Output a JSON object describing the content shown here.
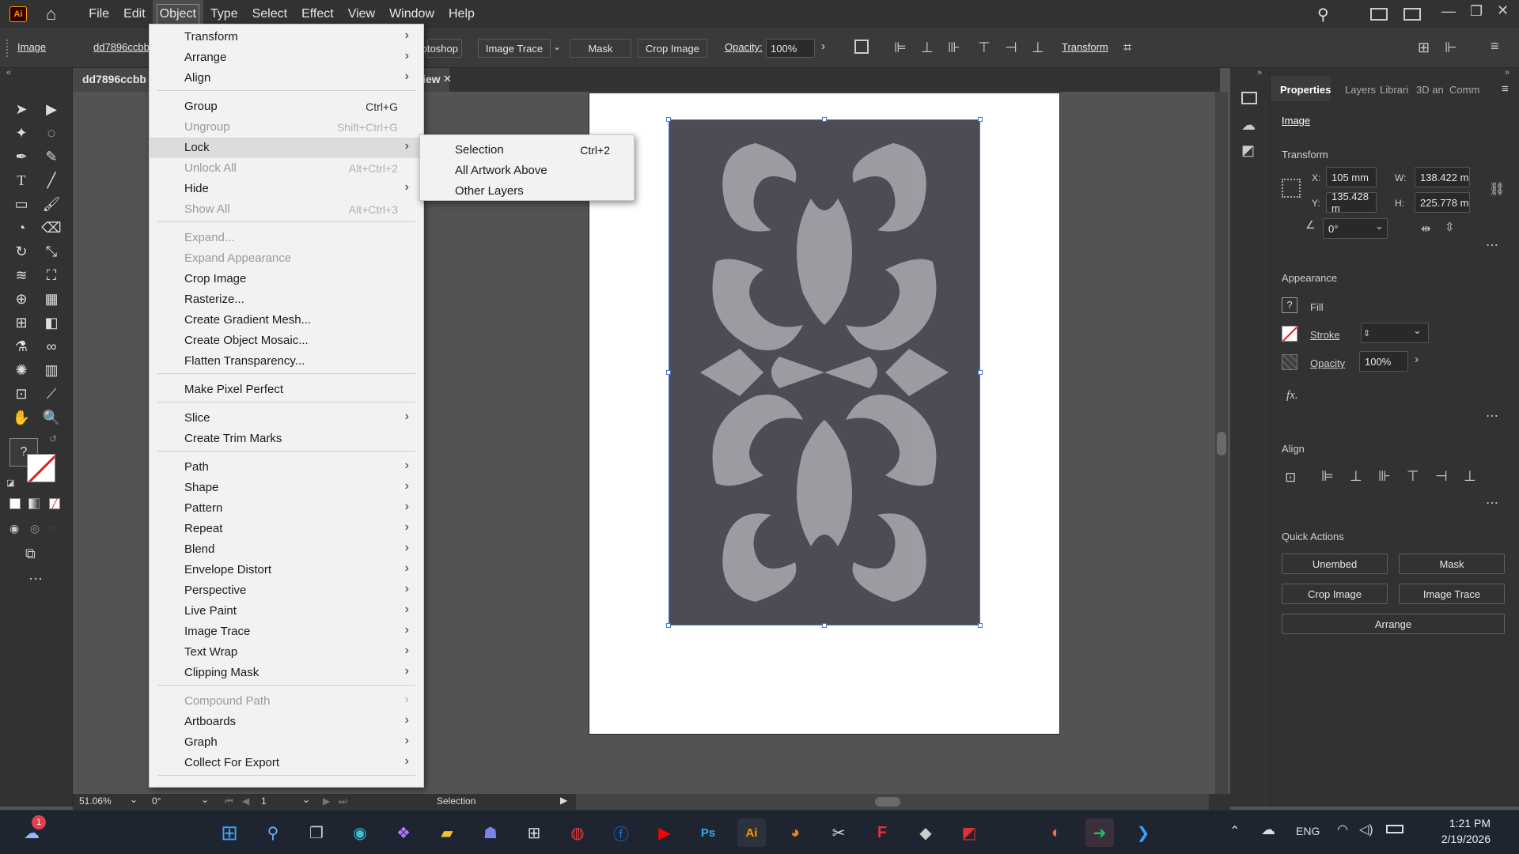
{
  "app": {
    "logo": "Ai"
  },
  "menubar": {
    "items": [
      "File",
      "Edit",
      "Object",
      "Type",
      "Select",
      "Effect",
      "View",
      "Window",
      "Help"
    ],
    "active": "Object"
  },
  "control_bar": {
    "selection_label": "Image",
    "filename": "dd7896ccbb",
    "photoshop_btn": "otoshop",
    "image_trace_btn": "Image Trace",
    "mask_btn": "Mask",
    "crop_image_btn": "Crop Image",
    "opacity_label": "Opacity:",
    "opacity_value": "100%",
    "transform_btn": "Transform"
  },
  "doc_tab": {
    "title": "dd7896ccbb",
    "tail": "iew"
  },
  "object_menu": {
    "items": [
      {
        "label": "Transform",
        "shortcut": "",
        "submenu": true,
        "disabled": false
      },
      {
        "label": "Arrange",
        "shortcut": "",
        "submenu": true,
        "disabled": false
      },
      {
        "label": "Align",
        "shortcut": "",
        "submenu": true,
        "disabled": false
      },
      {
        "label": "Group",
        "shortcut": "Ctrl+G",
        "submenu": false,
        "disabled": false
      },
      {
        "label": "Ungroup",
        "shortcut": "Shift+Ctrl+G",
        "submenu": false,
        "disabled": true
      },
      {
        "label": "Lock",
        "shortcut": "",
        "submenu": true,
        "disabled": false
      },
      {
        "label": "Unlock All",
        "shortcut": "Alt+Ctrl+2",
        "submenu": false,
        "disabled": true
      },
      {
        "label": "Hide",
        "shortcut": "",
        "submenu": true,
        "disabled": false
      },
      {
        "label": "Show All",
        "shortcut": "Alt+Ctrl+3",
        "submenu": false,
        "disabled": true
      },
      {
        "label": "Expand...",
        "shortcut": "",
        "submenu": false,
        "disabled": true
      },
      {
        "label": "Expand Appearance",
        "shortcut": "",
        "submenu": false,
        "disabled": true
      },
      {
        "label": "Crop Image",
        "shortcut": "",
        "submenu": false,
        "disabled": false
      },
      {
        "label": "Rasterize...",
        "shortcut": "",
        "submenu": false,
        "disabled": false
      },
      {
        "label": "Create Gradient Mesh...",
        "shortcut": "",
        "submenu": false,
        "disabled": false
      },
      {
        "label": "Create Object Mosaic...",
        "shortcut": "",
        "submenu": false,
        "disabled": false
      },
      {
        "label": "Flatten Transparency...",
        "shortcut": "",
        "submenu": false,
        "disabled": false
      },
      {
        "label": "Make Pixel Perfect",
        "shortcut": "",
        "submenu": false,
        "disabled": false
      },
      {
        "label": "Slice",
        "shortcut": "",
        "submenu": true,
        "disabled": false
      },
      {
        "label": "Create Trim Marks",
        "shortcut": "",
        "submenu": false,
        "disabled": false
      },
      {
        "label": "Path",
        "shortcut": "",
        "submenu": true,
        "disabled": false
      },
      {
        "label": "Shape",
        "shortcut": "",
        "submenu": true,
        "disabled": false
      },
      {
        "label": "Pattern",
        "shortcut": "",
        "submenu": true,
        "disabled": false
      },
      {
        "label": "Repeat",
        "shortcut": "",
        "submenu": true,
        "disabled": false
      },
      {
        "label": "Blend",
        "shortcut": "",
        "submenu": true,
        "disabled": false
      },
      {
        "label": "Envelope Distort",
        "shortcut": "",
        "submenu": true,
        "disabled": false
      },
      {
        "label": "Perspective",
        "shortcut": "",
        "submenu": true,
        "disabled": false
      },
      {
        "label": "Live Paint",
        "shortcut": "",
        "submenu": true,
        "disabled": false
      },
      {
        "label": "Image Trace",
        "shortcut": "",
        "submenu": true,
        "disabled": false
      },
      {
        "label": "Text Wrap",
        "shortcut": "",
        "submenu": true,
        "disabled": false
      },
      {
        "label": "Clipping Mask",
        "shortcut": "",
        "submenu": true,
        "disabled": false
      },
      {
        "label": "Compound Path",
        "shortcut": "",
        "submenu": true,
        "disabled": true
      },
      {
        "label": "Artboards",
        "shortcut": "",
        "submenu": true,
        "disabled": false
      },
      {
        "label": "Graph",
        "shortcut": "",
        "submenu": true,
        "disabled": false
      },
      {
        "label": "Collect For Export",
        "shortcut": "",
        "submenu": true,
        "disabled": false
      }
    ],
    "highlighted": "Lock"
  },
  "lock_submenu": {
    "items": [
      {
        "label": "Selection",
        "shortcut": "Ctrl+2"
      },
      {
        "label": "All Artwork Above",
        "shortcut": ""
      },
      {
        "label": "Other Layers",
        "shortcut": ""
      }
    ]
  },
  "properties": {
    "tabs": [
      "Properties",
      "Layers",
      "Librari",
      "3D an",
      "Comm"
    ],
    "selection_type": "Image",
    "transform_title": "Transform",
    "x_label": "X:",
    "x_value": "105 mm",
    "y_label": "Y:",
    "y_value": "135.428 m",
    "w_label": "W:",
    "w_value": "138.422 m",
    "h_label": "H:",
    "h_value": "225.778 m",
    "angle_value": "0°",
    "appearance_title": "Appearance",
    "fill_label": "Fill",
    "stroke_label": "Stroke",
    "opacity_label": "Opacity",
    "opacity_value": "100%",
    "fx_label": "fx.",
    "align_title": "Align",
    "quick_actions_title": "Quick Actions",
    "qa_unembed": "Unembed",
    "qa_mask": "Mask",
    "qa_crop": "Crop Image",
    "qa_trace": "Image Trace",
    "qa_arrange": "Arrange"
  },
  "status": {
    "zoom": "51.06%",
    "rotation": "0°",
    "artboard": "1",
    "tool": "Selection"
  },
  "taskbar": {
    "lang": "ENG",
    "time": "1:21 PM",
    "date": "2/19/2026",
    "notification_count": "1"
  },
  "colors": {
    "menu_bg": "#f2f2f2",
    "ui_dark": "#323232",
    "canvas": "#535353",
    "accent": "#4a78c8",
    "illustrator_orange": "#ff9a00"
  }
}
